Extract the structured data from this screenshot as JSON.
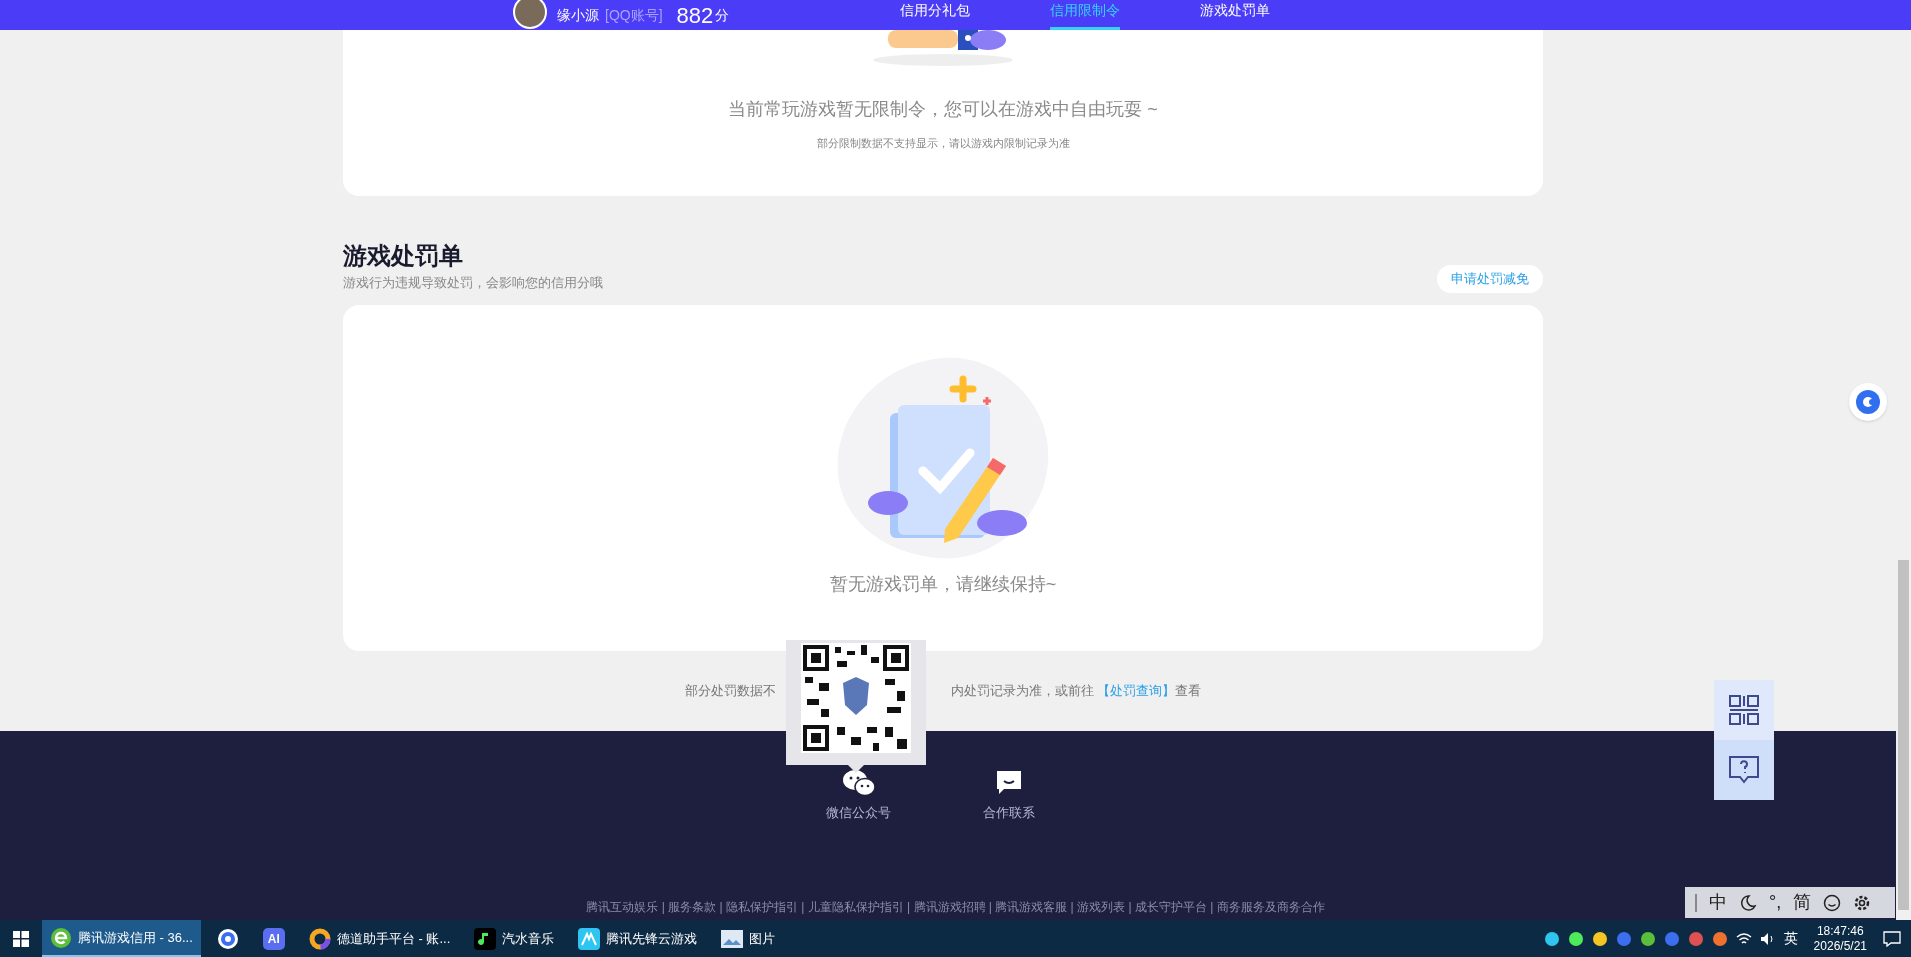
{
  "top_bar": {
    "username": "缘小源",
    "account_type": "[QQ账号]",
    "score": "882",
    "score_unit": "分",
    "tabs": [
      {
        "label": "信用分礼包",
        "selected": false
      },
      {
        "label": "信用限制令",
        "selected": true
      },
      {
        "label": "游戏处罚单",
        "selected": false
      }
    ]
  },
  "restriction_card": {
    "message": "当前常玩游戏暂无限制令，您可以在游戏中自由玩耍 ~",
    "note": "部分限制数据不支持显示，请以游戏内限制记录为准"
  },
  "penalty_section": {
    "title": "游戏处罚单",
    "subtitle": "游戏行为违规导致处罚，会影响您的信用分哦",
    "action_button": "申请处罚减免",
    "empty_message": "暂无游戏罚单，请继续保持~",
    "note_parts": [
      {
        "kind": "text",
        "text": "部分处罚数据不"
      },
      {
        "kind": "gap"
      },
      {
        "kind": "text",
        "text": "内处罚记录为准，或前往 "
      },
      {
        "kind": "link",
        "text": "【处罚查询】"
      },
      {
        "kind": "text",
        "text": "查看"
      }
    ]
  },
  "footer": {
    "contacts": [
      {
        "kind": "wechat",
        "label": "微信公众号"
      },
      {
        "kind": "chat",
        "label": "合作联系"
      }
    ],
    "links": "腾讯互动娱乐 | 服务条款 | 隐私保护指引 | 儿童隐私保护指引 | 腾讯游戏招聘 | 腾讯游戏客服 | 游戏列表 | 成长守护平台 | 商务服务及商务合作"
  },
  "ime_bar": {
    "items": [
      "中",
      "°,",
      "简"
    ]
  },
  "taskbar": {
    "apps": [
      {
        "kind": "browser",
        "label": "腾讯游戏信用 - 36...",
        "selected": true
      },
      {
        "kind": "circle",
        "selected": false
      },
      {
        "kind": "ai",
        "label": "AI",
        "selected": false
      },
      {
        "kind": "ring",
        "label": "德道助手平台 - 账...",
        "selected": false
      },
      {
        "kind": "music",
        "label": "汽水音乐",
        "selected": false
      },
      {
        "kind": "cloud",
        "label": "腾讯先锋云游戏",
        "selected": false
      },
      {
        "kind": "photo",
        "label": "图片",
        "selected": false
      }
    ],
    "ime_lang": "英",
    "time": "18:47:46",
    "date": "2026/5/21"
  }
}
